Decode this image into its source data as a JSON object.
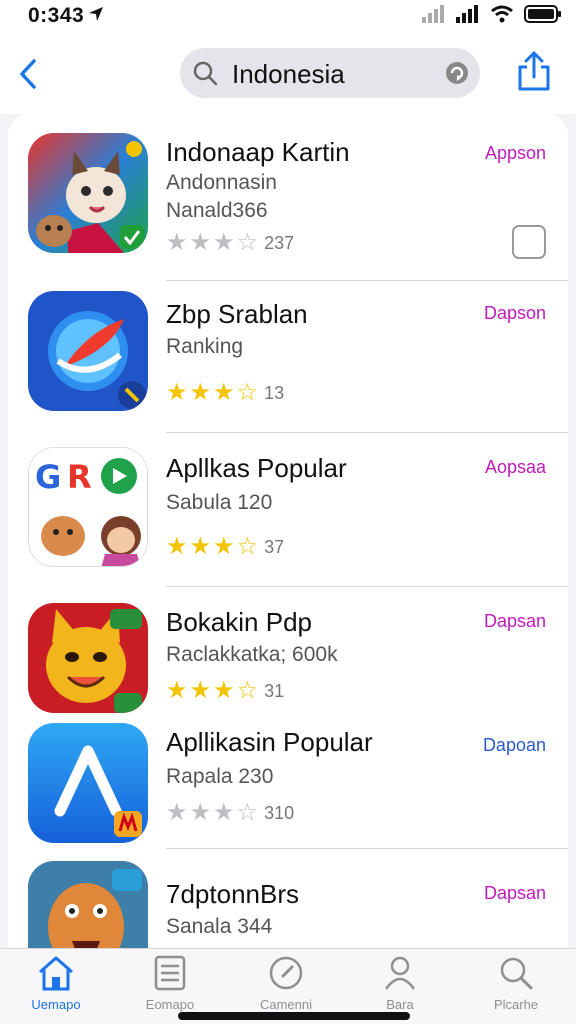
{
  "status_bar": {
    "time": "0:343"
  },
  "search": {
    "query": "Indonesia"
  },
  "apps": [
    {
      "name": "Indonaap Kartin",
      "subtitle": "Andonnasin",
      "subtitle2": "Nanald366",
      "rating": 3,
      "rating_count": "237",
      "action_label": "Appson"
    },
    {
      "name": "Zbp Srablan",
      "subtitle": "Ranking",
      "rating": 3,
      "rating_count": "13",
      "action_label": "Dapson"
    },
    {
      "name": "Apllkas Popular",
      "subtitle": "Sabula 120",
      "rating": 3,
      "rating_count": "37",
      "action_label": "Aopsaa"
    },
    {
      "name": "Bokakin Pdp",
      "subtitle": "Raclakkatka; 600k",
      "rating": 3,
      "rating_count": "31",
      "action_label": "Dapsan"
    },
    {
      "name": "Apllikasin Popular",
      "subtitle": "Rapala 230",
      "rating": 3,
      "rating_count": "310",
      "action_label": "Dapoan"
    },
    {
      "name": "7dptonnBrs",
      "subtitle": "Sanala 344",
      "action_label": "Dapsan"
    }
  ],
  "tabs": [
    {
      "label": "Uemapo",
      "icon": "home-icon"
    },
    {
      "label": "Eomapo",
      "icon": "list-icon"
    },
    {
      "label": "Camenni",
      "icon": "compass-icon"
    },
    {
      "label": "Bara",
      "icon": "person-icon"
    },
    {
      "label": "Plcarhe",
      "icon": "search-icon"
    }
  ],
  "colors": {
    "accent": "#1b74e8",
    "action_magenta": "#c21bbd",
    "star": "#f5c400"
  }
}
